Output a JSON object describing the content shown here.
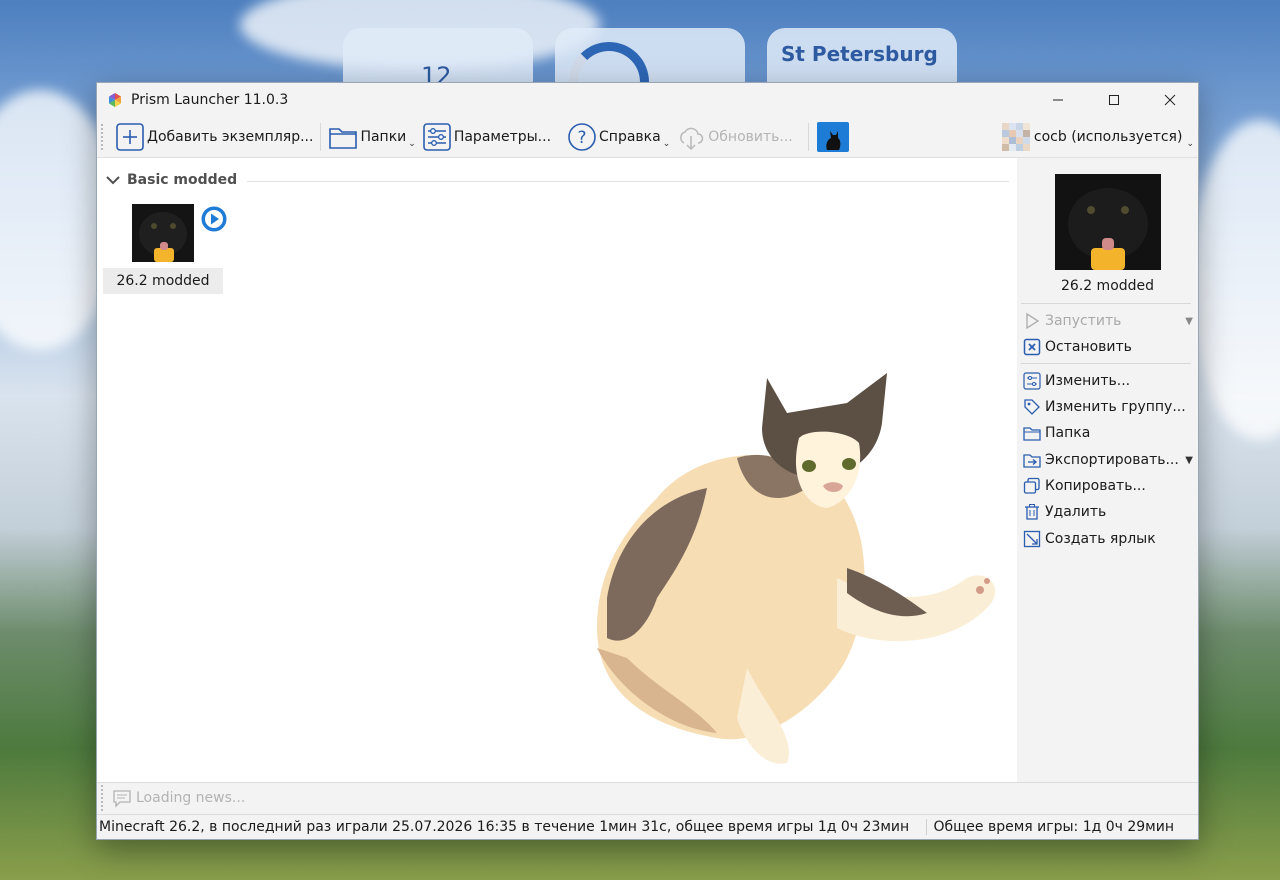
{
  "desktop": {
    "clock_value": "12",
    "weather_city": "St Petersburg"
  },
  "window": {
    "title": "Prism Launcher 11.0.3"
  },
  "toolbar": {
    "add_instance": "Добавить экземпляр...",
    "folders": "Папки",
    "settings": "Параметры...",
    "help": "Справка",
    "update": "Обновить...",
    "account": "cocb (используется)"
  },
  "group": {
    "name": "Basic modded"
  },
  "instance": {
    "name": "26.2 modded"
  },
  "sidebar": {
    "name": "26.2 modded",
    "launch": "Запустить",
    "kill": "Остановить",
    "edit": "Изменить...",
    "change_group": "Изменить группу...",
    "folder": "Папка",
    "export": "Экспортировать...",
    "copy": "Копировать...",
    "delete": "Удалить",
    "shortcut": "Создать ярлык"
  },
  "news": {
    "text": "Loading news..."
  },
  "status": {
    "left": "Minecraft 26.2, в последний раз играли 25.07.2026 16:35 в течение 1мин 31с, общее время игры 1д 0ч 23мин",
    "right": "Общее время игры: 1д 0ч 29мин"
  },
  "colors": {
    "accent": "#1e7bd6",
    "link_blue": "#2b5db0"
  }
}
